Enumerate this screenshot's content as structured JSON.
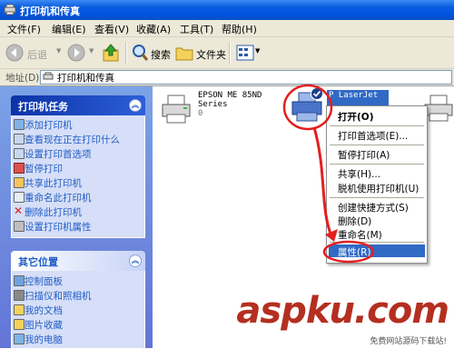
{
  "window": {
    "title": "打印机和传真"
  },
  "menu": [
    "文件(F)",
    "编辑(E)",
    "查看(V)",
    "收藏(A)",
    "工具(T)",
    "帮助(H)"
  ],
  "toolbar": {
    "back": "后退",
    "search": "搜索",
    "folders": "文件夹"
  },
  "address": {
    "label": "地址(D)",
    "value": "打印机和传真"
  },
  "tasks": {
    "title": "打印机任务",
    "items": [
      "添加打印机",
      "查看现在正在打印什么",
      "设置打印首选项",
      "暂停打印",
      "共享此打印机",
      "重命名此打印机",
      "删除此打印机",
      "设置打印机属性"
    ]
  },
  "other": {
    "title": "其它位置",
    "items": [
      "控制面板",
      "扫描仪和照相机",
      "我的文档",
      "图片收藏",
      "我的电脑"
    ]
  },
  "printers": [
    {
      "name_line1": "EPSON ME 85ND",
      "name_line2": "Series",
      "count": "0"
    },
    {
      "name_line1": "P LaserJet",
      "name_line2": "",
      "count": ""
    }
  ],
  "context_menu": [
    "打开(O)",
    "打印首选项(E)...",
    "暂停打印(A)",
    "共享(H)...",
    "脱机使用打印机(U)",
    "创建快捷方式(S)",
    "删除(D)",
    "重命名(M)",
    "属性(R)"
  ],
  "watermark": {
    "text": "aspku.com",
    "sub": "免费网站源码下载站!"
  },
  "colors": {
    "titlebar": "#0054e3",
    "leftpane": "#7ba2e7",
    "highlight": "#316ac5",
    "annotation": "#e41f1f"
  }
}
